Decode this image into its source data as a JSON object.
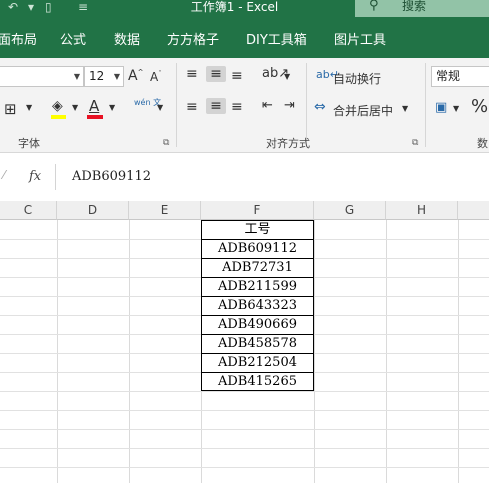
{
  "titlebar": {
    "title": "工作簿1  -  Excel",
    "undo_icon": "undo-arrow-icon",
    "save_icon": "document-icon",
    "qat_more_icon": "dropdown-icon",
    "search_placeholder": "搜索"
  },
  "tabs": [
    "面布局",
    "公式",
    "数据",
    "方方格子",
    "DIY工具箱",
    "图片工具"
  ],
  "font_group": {
    "label": "字体",
    "font_size": "12",
    "grow_label": "A",
    "shrink_label": "A",
    "wen_label": "wén 文"
  },
  "alignment_group": {
    "label": "对齐方式",
    "wrap_text": "自动换行",
    "merge_center": "合并后居中"
  },
  "number_group": {
    "format": "常规",
    "label_partial": "数"
  },
  "formula_bar": {
    "fx": "fx",
    "value": "ADB609112"
  },
  "columns": [
    "C",
    "D",
    "E",
    "F",
    "G",
    "H"
  ],
  "table": {
    "header": "工号",
    "rows": [
      "ADB609112",
      "ADB72731",
      "ADB211599",
      "ADB643323",
      "ADB490669",
      "ADB458578",
      "ADB212504",
      "ADB415265"
    ]
  },
  "colors": {
    "brand_green": "#217346",
    "fill_yellow": "#ffff00",
    "font_red": "#e81123"
  }
}
